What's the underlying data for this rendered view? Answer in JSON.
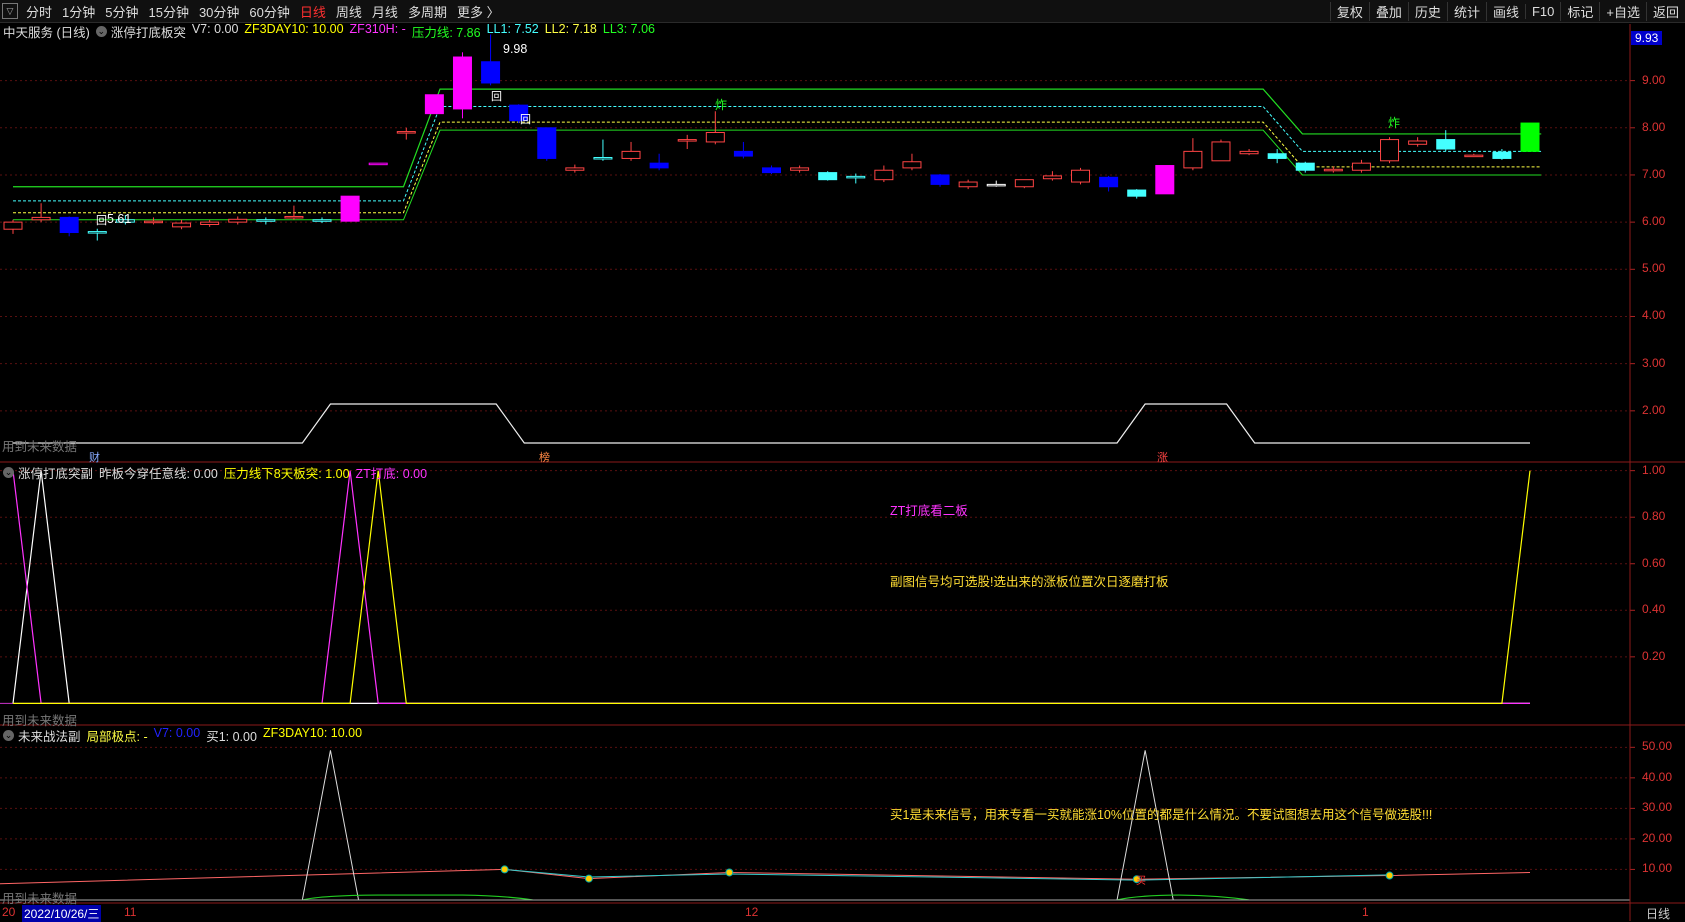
{
  "toolbar": {
    "periods": [
      "分时",
      "1分钟",
      "5分钟",
      "15分钟",
      "30分钟",
      "60分钟",
      "日线",
      "周线",
      "月线",
      "多周期",
      "更多 〉"
    ],
    "active_period": "日线",
    "tools": [
      "复权",
      "叠加",
      "历史",
      "统计",
      "画线",
      "F10",
      "标记",
      "+自选",
      "返回"
    ]
  },
  "main_legend": {
    "stock": "中天服务 (日线)",
    "indicator": "涨停打底板突",
    "items": [
      {
        "text": "V7: 0.00",
        "color": "#dddddd"
      },
      {
        "text": "ZF3DAY10: 10.00",
        "color": "#ffff00"
      },
      {
        "text": "ZF310H: -",
        "color": "#ff33ff"
      },
      {
        "text": "压力线: 7.86",
        "color": "#22ff22"
      },
      {
        "text": "LL1: 7.52",
        "color": "#44ffff"
      },
      {
        "text": "LL2: 7.18",
        "color": "#ffff44"
      },
      {
        "text": "LL3: 7.06",
        "color": "#22ff22"
      }
    ],
    "price_box": "9.93"
  },
  "sub1_legend": {
    "indicator": "涨停打底突副",
    "items": [
      {
        "text": "昨板今穿任意线: 0.00",
        "color": "#dddddd"
      },
      {
        "text": "压力线下8天板突: 1.00",
        "color": "#ffff00"
      },
      {
        "text": "ZT打底: 0.00",
        "color": "#ff33ff"
      }
    ]
  },
  "sub2_legend": {
    "indicator": "未来战法副",
    "items": [
      {
        "text": "局部极点: -",
        "color": "#ffff44"
      },
      {
        "text": "V7: 0.00",
        "color": "#2222ff"
      },
      {
        "text": "买1: 0.00",
        "color": "#dddddd"
      },
      {
        "text": "ZF3DAY10: 10.00",
        "color": "#ffff00"
      }
    ]
  },
  "annotations": {
    "high_label": "9.98",
    "low_label": "5.61",
    "future_data_note": "用到未来数据",
    "marker_cai": "财",
    "marker_bang": "榜",
    "marker_zhang": "涨",
    "marker_zha": "炸",
    "marker_hui": "回",
    "sub1_title_note": "ZT打底看二板",
    "sub1_desc": "副图信号均可选股!选出来的涨板位置次日逐磨打板",
    "sub2_desc": "买1是未来信号，用来专看一买就能涨10%位置的都是什么情况。不要试图想去用这个信号做选股!!!",
    "buy_label": "买"
  },
  "bottom_axis": {
    "date_box": "2022/10/26/三",
    "labels": [
      "20",
      "11",
      "12",
      "1"
    ],
    "period_label": "日线"
  },
  "chart_data": [
    {
      "type": "candlestick",
      "title": "中天服务 (日线)",
      "y_ticks": [
        2,
        3,
        4,
        5,
        6,
        7,
        8,
        9
      ],
      "y_tick_labels": [
        "2.00",
        "3.00",
        "4.00",
        "5.00",
        "6.00",
        "7.00",
        "8.00",
        "9.00"
      ],
      "ylim": [
        1.0,
        10.2
      ],
      "candles": [
        {
          "o": 5.85,
          "c": 6.0,
          "h": 6.05,
          "l": 5.75,
          "col": "#ff4444",
          "fill": false
        },
        {
          "o": 6.05,
          "c": 6.1,
          "h": 6.4,
          "l": 6.0,
          "col": "#ff4444",
          "fill": false
        },
        {
          "o": 6.1,
          "c": 5.78,
          "h": 6.12,
          "l": 5.7,
          "col": "#0000ff",
          "fill": true
        },
        {
          "o": 5.8,
          "c": 5.78,
          "h": 5.86,
          "l": 5.61,
          "col": "#44ffff",
          "fill": false
        },
        {
          "o": 6.0,
          "c": 6.05,
          "h": 6.15,
          "l": 5.95,
          "col": "#44ffff",
          "fill": false
        },
        {
          "o": 6.0,
          "c": 6.02,
          "h": 6.1,
          "l": 5.95,
          "col": "#ff4444",
          "fill": false
        },
        {
          "o": 5.9,
          "c": 5.98,
          "h": 6.05,
          "l": 5.85,
          "col": "#ff4444",
          "fill": false
        },
        {
          "o": 5.95,
          "c": 6.0,
          "h": 6.05,
          "l": 5.9,
          "col": "#ff4444",
          "fill": false
        },
        {
          "o": 6.0,
          "c": 6.06,
          "h": 6.12,
          "l": 5.95,
          "col": "#ff4444",
          "fill": false
        },
        {
          "o": 6.05,
          "c": 6.02,
          "h": 6.1,
          "l": 5.95,
          "col": "#44ffff",
          "fill": false
        },
        {
          "o": 6.1,
          "c": 6.12,
          "h": 6.35,
          "l": 6.05,
          "col": "#ff4444",
          "fill": false
        },
        {
          "o": 6.05,
          "c": 6.02,
          "h": 6.1,
          "l": 5.98,
          "col": "#44ffff",
          "fill": false
        },
        {
          "o": 6.02,
          "c": 6.55,
          "h": 6.55,
          "l": 6.02,
          "col": "#ff00ff",
          "fill": true
        },
        {
          "o": 7.25,
          "c": 7.25,
          "h": 7.25,
          "l": 7.25,
          "col": "#ff00ff",
          "fill": false
        },
        {
          "o": 7.9,
          "c": 7.92,
          "h": 8.0,
          "l": 7.75,
          "col": "#ff4444",
          "fill": false
        },
        {
          "o": 8.3,
          "c": 8.7,
          "h": 8.7,
          "l": 8.3,
          "col": "#ff00ff",
          "fill": true
        },
        {
          "o": 8.4,
          "c": 9.5,
          "h": 9.6,
          "l": 8.2,
          "col": "#ff00ff",
          "fill": true
        },
        {
          "o": 9.4,
          "c": 8.95,
          "h": 9.98,
          "l": 8.9,
          "col": "#0000ff",
          "fill": true
        },
        {
          "o": 8.48,
          "c": 8.15,
          "h": 8.5,
          "l": 8.1,
          "col": "#0000ff",
          "fill": true
        },
        {
          "o": 8.0,
          "c": 7.35,
          "h": 8.0,
          "l": 7.3,
          "col": "#0000ff",
          "fill": true
        },
        {
          "o": 7.1,
          "c": 7.15,
          "h": 7.22,
          "l": 7.05,
          "col": "#ff4444",
          "fill": false
        },
        {
          "o": 7.35,
          "c": 7.37,
          "h": 7.75,
          "l": 7.3,
          "col": "#44ffff",
          "fill": false
        },
        {
          "o": 7.35,
          "c": 7.5,
          "h": 7.7,
          "l": 7.3,
          "col": "#ff4444",
          "fill": false
        },
        {
          "o": 7.25,
          "c": 7.15,
          "h": 7.45,
          "l": 7.1,
          "col": "#0000ff",
          "fill": true
        },
        {
          "o": 7.72,
          "c": 7.75,
          "h": 7.85,
          "l": 7.55,
          "col": "#ff4444",
          "fill": false
        },
        {
          "o": 7.7,
          "c": 7.9,
          "h": 8.35,
          "l": 7.65,
          "col": "#ff4444",
          "fill": false
        },
        {
          "o": 7.5,
          "c": 7.4,
          "h": 7.7,
          "l": 7.35,
          "col": "#0000ff",
          "fill": true
        },
        {
          "o": 7.15,
          "c": 7.05,
          "h": 7.2,
          "l": 7.02,
          "col": "#0000ff",
          "fill": true
        },
        {
          "o": 7.1,
          "c": 7.15,
          "h": 7.2,
          "l": 7.05,
          "col": "#ff4444",
          "fill": false
        },
        {
          "o": 7.05,
          "c": 6.9,
          "h": 7.08,
          "l": 6.88,
          "col": "#44ffff",
          "fill": true
        },
        {
          "o": 6.95,
          "c": 6.97,
          "h": 7.03,
          "l": 6.82,
          "col": "#44ffff",
          "fill": false
        },
        {
          "o": 6.9,
          "c": 7.1,
          "h": 7.2,
          "l": 6.85,
          "col": "#ff4444",
          "fill": false
        },
        {
          "o": 7.15,
          "c": 7.28,
          "h": 7.45,
          "l": 7.1,
          "col": "#ff4444",
          "fill": false
        },
        {
          "o": 7.0,
          "c": 6.8,
          "h": 7.02,
          "l": 6.75,
          "col": "#0000ff",
          "fill": true
        },
        {
          "o": 6.75,
          "c": 6.85,
          "h": 6.9,
          "l": 6.7,
          "col": "#ff4444",
          "fill": false
        },
        {
          "o": 6.8,
          "c": 6.8,
          "h": 6.88,
          "l": 6.75,
          "col": "#ffffff",
          "fill": false
        },
        {
          "o": 6.75,
          "c": 6.9,
          "h": 6.9,
          "l": 6.72,
          "col": "#ff4444",
          "fill": false
        },
        {
          "o": 6.92,
          "c": 6.98,
          "h": 7.08,
          "l": 6.88,
          "col": "#ff4444",
          "fill": false
        },
        {
          "o": 6.85,
          "c": 7.1,
          "h": 7.15,
          "l": 6.8,
          "col": "#ff4444",
          "fill": false
        },
        {
          "o": 6.95,
          "c": 6.75,
          "h": 6.98,
          "l": 6.65,
          "col": "#0000ff",
          "fill": true
        },
        {
          "o": 6.68,
          "c": 6.55,
          "h": 6.7,
          "l": 6.5,
          "col": "#44ffff",
          "fill": true
        },
        {
          "o": 6.6,
          "c": 7.2,
          "h": 7.2,
          "l": 6.6,
          "col": "#ff00ff",
          "fill": true
        },
        {
          "o": 7.15,
          "c": 7.5,
          "h": 7.78,
          "l": 7.1,
          "col": "#ff4444",
          "fill": false
        },
        {
          "o": 7.3,
          "c": 7.7,
          "h": 7.75,
          "l": 7.3,
          "col": "#ff4444",
          "fill": false
        },
        {
          "o": 7.45,
          "c": 7.5,
          "h": 7.55,
          "l": 7.42,
          "col": "#ff4444",
          "fill": false
        },
        {
          "o": 7.45,
          "c": 7.35,
          "h": 7.55,
          "l": 7.25,
          "col": "#44ffff",
          "fill": true
        },
        {
          "o": 7.25,
          "c": 7.1,
          "h": 7.28,
          "l": 7.05,
          "col": "#44ffff",
          "fill": true
        },
        {
          "o": 7.1,
          "c": 7.12,
          "h": 7.18,
          "l": 7.05,
          "col": "#ff4444",
          "fill": false
        },
        {
          "o": 7.1,
          "c": 7.25,
          "h": 7.32,
          "l": 7.05,
          "col": "#ff4444",
          "fill": false
        },
        {
          "o": 7.3,
          "c": 7.75,
          "h": 7.8,
          "l": 7.25,
          "col": "#ff4444",
          "fill": false
        },
        {
          "o": 7.65,
          "c": 7.72,
          "h": 7.8,
          "l": 7.6,
          "col": "#ff4444",
          "fill": false
        },
        {
          "o": 7.75,
          "c": 7.55,
          "h": 7.95,
          "l": 7.5,
          "col": "#44ffff",
          "fill": true
        },
        {
          "o": 7.4,
          "c": 7.42,
          "h": 7.45,
          "l": 7.38,
          "col": "#ff4444",
          "fill": false
        },
        {
          "o": 7.48,
          "c": 7.35,
          "h": 7.55,
          "l": 7.32,
          "col": "#44ffff",
          "fill": true
        },
        {
          "o": 7.5,
          "c": 8.1,
          "h": 8.1,
          "l": 7.5,
          "col": "#00ff00",
          "fill": true
        }
      ]
    },
    {
      "type": "line",
      "title": "涨停打底突副",
      "y_ticks": [
        0.2,
        0.4,
        0.6,
        0.8,
        1.0
      ],
      "y_tick_labels": [
        "0.20",
        "0.40",
        "0.60",
        "0.80",
        "1.00"
      ],
      "ylim": [
        -0.08,
        1.02
      ],
      "series": [
        {
          "name": "昨板今穿任意线",
          "color": "#ffffff",
          "values": [
            0,
            1,
            0,
            0,
            0,
            0,
            0,
            0,
            0,
            0,
            0,
            0,
            0,
            0,
            0,
            0,
            0,
            0,
            0,
            0,
            0,
            0,
            0,
            0,
            0,
            0,
            0,
            0,
            0,
            0,
            0,
            0,
            0,
            0,
            0,
            0,
            0,
            0,
            0,
            0,
            0,
            0,
            0,
            0,
            0,
            0,
            0,
            0,
            0,
            0,
            0,
            0,
            0,
            0,
            0
          ]
        },
        {
          "name": "ZT打底",
          "color": "#ff33ff",
          "values": [
            1,
            0,
            0,
            0,
            0,
            0,
            0,
            0,
            0,
            0,
            0,
            0,
            1,
            0,
            0,
            0,
            0,
            0,
            0,
            0,
            0,
            0,
            0,
            0,
            0,
            0,
            0,
            0,
            0,
            0,
            0,
            0,
            0,
            0,
            0,
            0,
            0,
            0,
            0,
            0,
            0,
            0,
            0,
            0,
            0,
            0,
            0,
            0,
            0,
            0,
            0,
            0,
            0,
            0,
            0
          ]
        },
        {
          "name": "压力线下8天板突",
          "color": "#ffff00",
          "values": [
            0,
            0,
            0,
            0,
            0,
            0,
            0,
            0,
            0,
            0,
            0,
            0,
            0,
            1,
            0,
            0,
            0,
            0,
            0,
            0,
            0,
            0,
            0,
            0,
            0,
            0,
            0,
            0,
            0,
            0,
            0,
            0,
            0,
            0,
            0,
            0,
            0,
            0,
            0,
            0,
            0,
            0,
            0,
            0,
            0,
            0,
            0,
            0,
            0,
            0,
            0,
            0,
            0,
            0,
            1
          ]
        }
      ]
    },
    {
      "type": "line",
      "title": "未来战法副",
      "y_ticks": [
        10,
        20,
        30,
        40,
        50
      ],
      "y_tick_labels": [
        "10.00",
        "20.00",
        "30.00",
        "40.00",
        "50.00"
      ],
      "ylim": [
        -1,
        56
      ]
    }
  ]
}
